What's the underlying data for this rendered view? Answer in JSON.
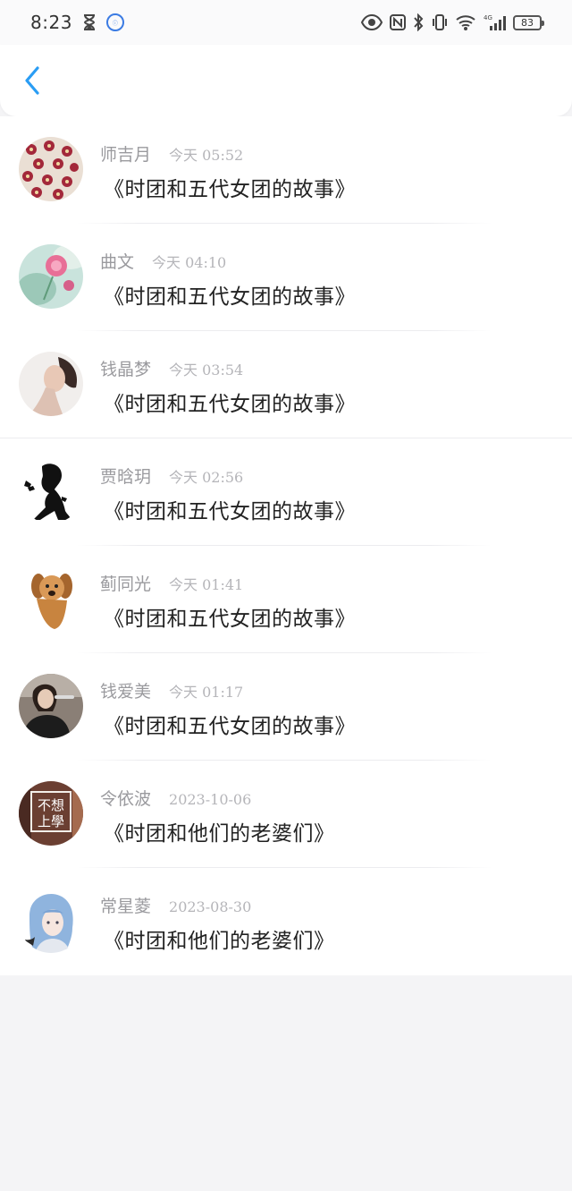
{
  "status_bar": {
    "time": "8:23",
    "battery": "83",
    "network": "4G",
    "icons": [
      "hourglass-icon",
      "app-badge-icon",
      "eye-icon",
      "nfc-icon",
      "bluetooth-icon",
      "vibrate-icon",
      "wifi-icon",
      "signal-icon",
      "battery-icon"
    ]
  },
  "header": {
    "back_icon": "chevron-left-icon",
    "accent_color": "#2a9df4"
  },
  "items": [
    {
      "name": "师吉月",
      "time": "今天 05:52",
      "title": "《时团和五代女团的故事》",
      "avatar": "flowers-pattern"
    },
    {
      "name": "曲文",
      "time": "今天 04:10",
      "title": "《时团和五代女团的故事》",
      "avatar": "pink-rose"
    },
    {
      "name": "钱晶梦",
      "time": "今天 03:54",
      "title": "《时团和五代女团的故事》",
      "avatar": "portrait-woman"
    },
    {
      "name": "贾晗玥",
      "time": "今天 02:56",
      "title": "《时团和五代女团的故事》",
      "avatar": "silhouette-girl-butterflies"
    },
    {
      "name": "蓟同光",
      "time": "今天 01:41",
      "title": "《时团和五代女团的故事》",
      "avatar": "puppy"
    },
    {
      "name": "钱爱美",
      "time": "今天 01:17",
      "title": "《时团和五代女团的故事》",
      "avatar": "photo-woman"
    },
    {
      "name": "令依波",
      "time": "2023-10-06",
      "title": "《时团和他们的老婆们》",
      "avatar": "text-badge",
      "avatar_text": [
        "不想",
        "上學"
      ]
    },
    {
      "name": "常星菱",
      "time": "2023-08-30",
      "title": "《时团和他们的老婆们》",
      "avatar": "anime-blue-hair"
    }
  ]
}
